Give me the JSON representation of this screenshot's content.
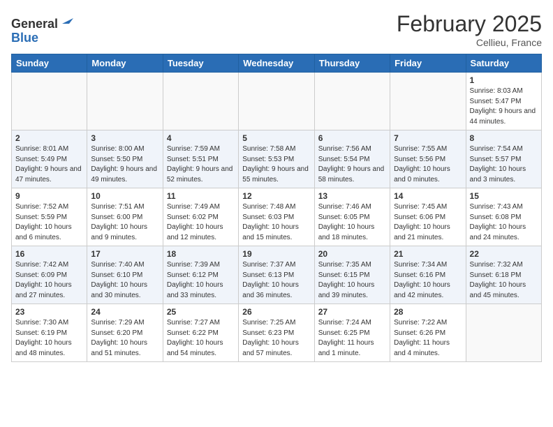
{
  "header": {
    "logo_line1": "General",
    "logo_line2": "Blue",
    "month": "February 2025",
    "location": "Cellieu, France"
  },
  "weekdays": [
    "Sunday",
    "Monday",
    "Tuesday",
    "Wednesday",
    "Thursday",
    "Friday",
    "Saturday"
  ],
  "weeks": [
    [
      {
        "day": "",
        "info": ""
      },
      {
        "day": "",
        "info": ""
      },
      {
        "day": "",
        "info": ""
      },
      {
        "day": "",
        "info": ""
      },
      {
        "day": "",
        "info": ""
      },
      {
        "day": "",
        "info": ""
      },
      {
        "day": "1",
        "info": "Sunrise: 8:03 AM\nSunset: 5:47 PM\nDaylight: 9 hours and 44 minutes."
      }
    ],
    [
      {
        "day": "2",
        "info": "Sunrise: 8:01 AM\nSunset: 5:49 PM\nDaylight: 9 hours and 47 minutes."
      },
      {
        "day": "3",
        "info": "Sunrise: 8:00 AM\nSunset: 5:50 PM\nDaylight: 9 hours and 49 minutes."
      },
      {
        "day": "4",
        "info": "Sunrise: 7:59 AM\nSunset: 5:51 PM\nDaylight: 9 hours and 52 minutes."
      },
      {
        "day": "5",
        "info": "Sunrise: 7:58 AM\nSunset: 5:53 PM\nDaylight: 9 hours and 55 minutes."
      },
      {
        "day": "6",
        "info": "Sunrise: 7:56 AM\nSunset: 5:54 PM\nDaylight: 9 hours and 58 minutes."
      },
      {
        "day": "7",
        "info": "Sunrise: 7:55 AM\nSunset: 5:56 PM\nDaylight: 10 hours and 0 minutes."
      },
      {
        "day": "8",
        "info": "Sunrise: 7:54 AM\nSunset: 5:57 PM\nDaylight: 10 hours and 3 minutes."
      }
    ],
    [
      {
        "day": "9",
        "info": "Sunrise: 7:52 AM\nSunset: 5:59 PM\nDaylight: 10 hours and 6 minutes."
      },
      {
        "day": "10",
        "info": "Sunrise: 7:51 AM\nSunset: 6:00 PM\nDaylight: 10 hours and 9 minutes."
      },
      {
        "day": "11",
        "info": "Sunrise: 7:49 AM\nSunset: 6:02 PM\nDaylight: 10 hours and 12 minutes."
      },
      {
        "day": "12",
        "info": "Sunrise: 7:48 AM\nSunset: 6:03 PM\nDaylight: 10 hours and 15 minutes."
      },
      {
        "day": "13",
        "info": "Sunrise: 7:46 AM\nSunset: 6:05 PM\nDaylight: 10 hours and 18 minutes."
      },
      {
        "day": "14",
        "info": "Sunrise: 7:45 AM\nSunset: 6:06 PM\nDaylight: 10 hours and 21 minutes."
      },
      {
        "day": "15",
        "info": "Sunrise: 7:43 AM\nSunset: 6:08 PM\nDaylight: 10 hours and 24 minutes."
      }
    ],
    [
      {
        "day": "16",
        "info": "Sunrise: 7:42 AM\nSunset: 6:09 PM\nDaylight: 10 hours and 27 minutes."
      },
      {
        "day": "17",
        "info": "Sunrise: 7:40 AM\nSunset: 6:10 PM\nDaylight: 10 hours and 30 minutes."
      },
      {
        "day": "18",
        "info": "Sunrise: 7:39 AM\nSunset: 6:12 PM\nDaylight: 10 hours and 33 minutes."
      },
      {
        "day": "19",
        "info": "Sunrise: 7:37 AM\nSunset: 6:13 PM\nDaylight: 10 hours and 36 minutes."
      },
      {
        "day": "20",
        "info": "Sunrise: 7:35 AM\nSunset: 6:15 PM\nDaylight: 10 hours and 39 minutes."
      },
      {
        "day": "21",
        "info": "Sunrise: 7:34 AM\nSunset: 6:16 PM\nDaylight: 10 hours and 42 minutes."
      },
      {
        "day": "22",
        "info": "Sunrise: 7:32 AM\nSunset: 6:18 PM\nDaylight: 10 hours and 45 minutes."
      }
    ],
    [
      {
        "day": "23",
        "info": "Sunrise: 7:30 AM\nSunset: 6:19 PM\nDaylight: 10 hours and 48 minutes."
      },
      {
        "day": "24",
        "info": "Sunrise: 7:29 AM\nSunset: 6:20 PM\nDaylight: 10 hours and 51 minutes."
      },
      {
        "day": "25",
        "info": "Sunrise: 7:27 AM\nSunset: 6:22 PM\nDaylight: 10 hours and 54 minutes."
      },
      {
        "day": "26",
        "info": "Sunrise: 7:25 AM\nSunset: 6:23 PM\nDaylight: 10 hours and 57 minutes."
      },
      {
        "day": "27",
        "info": "Sunrise: 7:24 AM\nSunset: 6:25 PM\nDaylight: 11 hours and 1 minute."
      },
      {
        "day": "28",
        "info": "Sunrise: 7:22 AM\nSunset: 6:26 PM\nDaylight: 11 hours and 4 minutes."
      },
      {
        "day": "",
        "info": ""
      }
    ]
  ]
}
